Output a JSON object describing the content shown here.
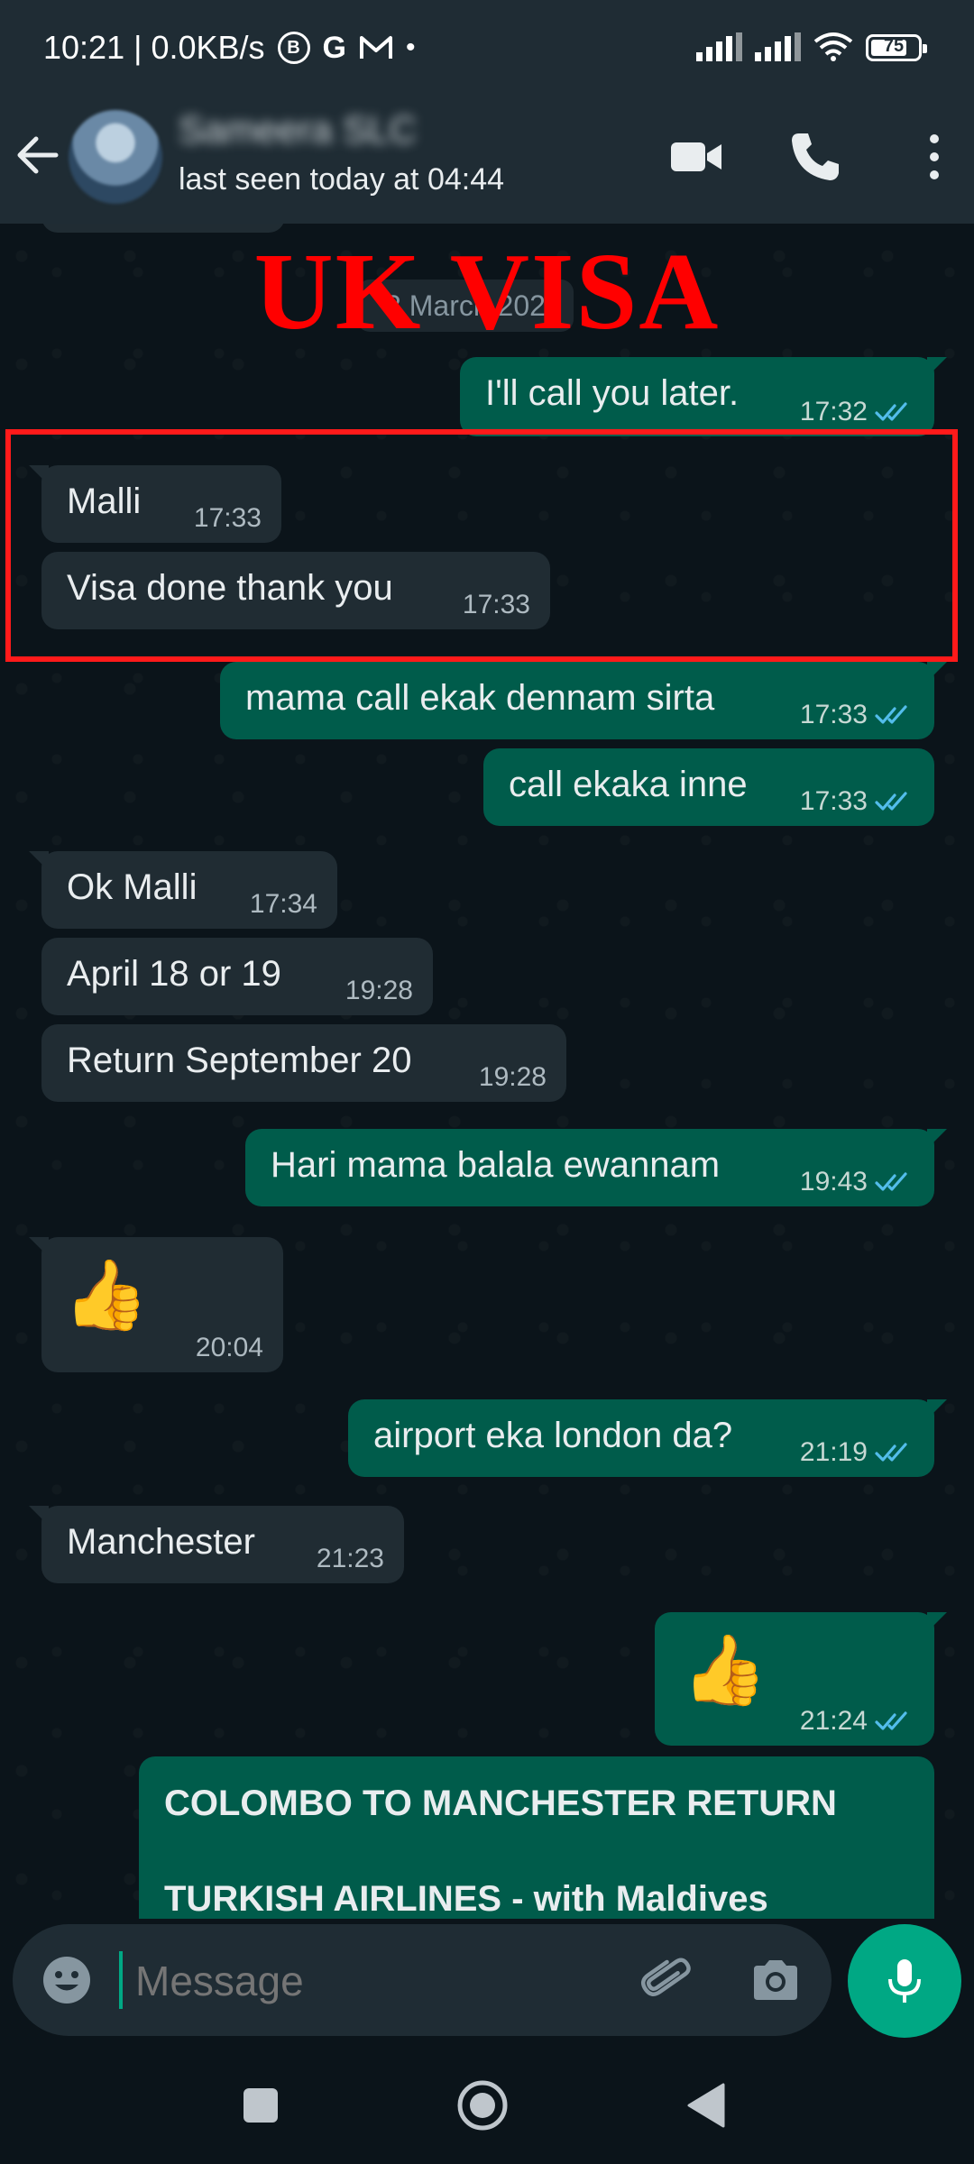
{
  "status_bar": {
    "time_info": "10:21 | 0.0KB/s",
    "battery": "75",
    "icons": [
      "b-circle-icon",
      "g-icon",
      "gmail-icon",
      "dot-icon",
      "signal-icon",
      "signal-icon",
      "wifi-icon",
      "battery-icon"
    ]
  },
  "header": {
    "contact_name": "Sameera SLC",
    "last_seen": "last seen today at 04:44"
  },
  "chat": {
    "date_chip": "3 March 202",
    "overlay_title": "UK VISA",
    "messages": [
      {
        "dir": "out",
        "text": "I'll call you later.",
        "time": "17:32",
        "read": true
      },
      {
        "dir": "in",
        "text": "Malli",
        "time": "17:33"
      },
      {
        "dir": "in",
        "text": "Visa done thank you",
        "time": "17:33"
      },
      {
        "dir": "out",
        "text": "mama call ekak dennam sirta",
        "time": "17:33",
        "read": true
      },
      {
        "dir": "out",
        "text": "call ekaka inne",
        "time": "17:33",
        "read": true
      },
      {
        "dir": "in",
        "text": "Ok Malli",
        "time": "17:34"
      },
      {
        "dir": "in",
        "text": "April 18 or 19",
        "time": "19:28"
      },
      {
        "dir": "in",
        "text": "Return September 20",
        "time": "19:28"
      },
      {
        "dir": "out",
        "text": "Hari mama balala ewannam",
        "time": "19:43",
        "read": true
      },
      {
        "dir": "in",
        "text": "👍",
        "time": "20:04"
      },
      {
        "dir": "out",
        "text": "airport eka london da?",
        "time": "21:19",
        "read": true
      },
      {
        "dir": "in",
        "text": "Manchester",
        "time": "21:23"
      },
      {
        "dir": "out",
        "text": "👍",
        "time": "21:24",
        "read": true
      }
    ],
    "flight_message": {
      "line1": "COLOMBO TO MANCHESTER RETURN",
      "line2": "TURKISH AIRLINES -  with Maldives"
    }
  },
  "composer": {
    "placeholder": "Message"
  },
  "colors": {
    "header_bg": "#1f2c34",
    "incoming_bubble": "#202c33",
    "outgoing_bubble": "#005c4b",
    "accent": "#00a884",
    "ticks": "#53bdeb",
    "overlay_red": "#ff0000"
  }
}
